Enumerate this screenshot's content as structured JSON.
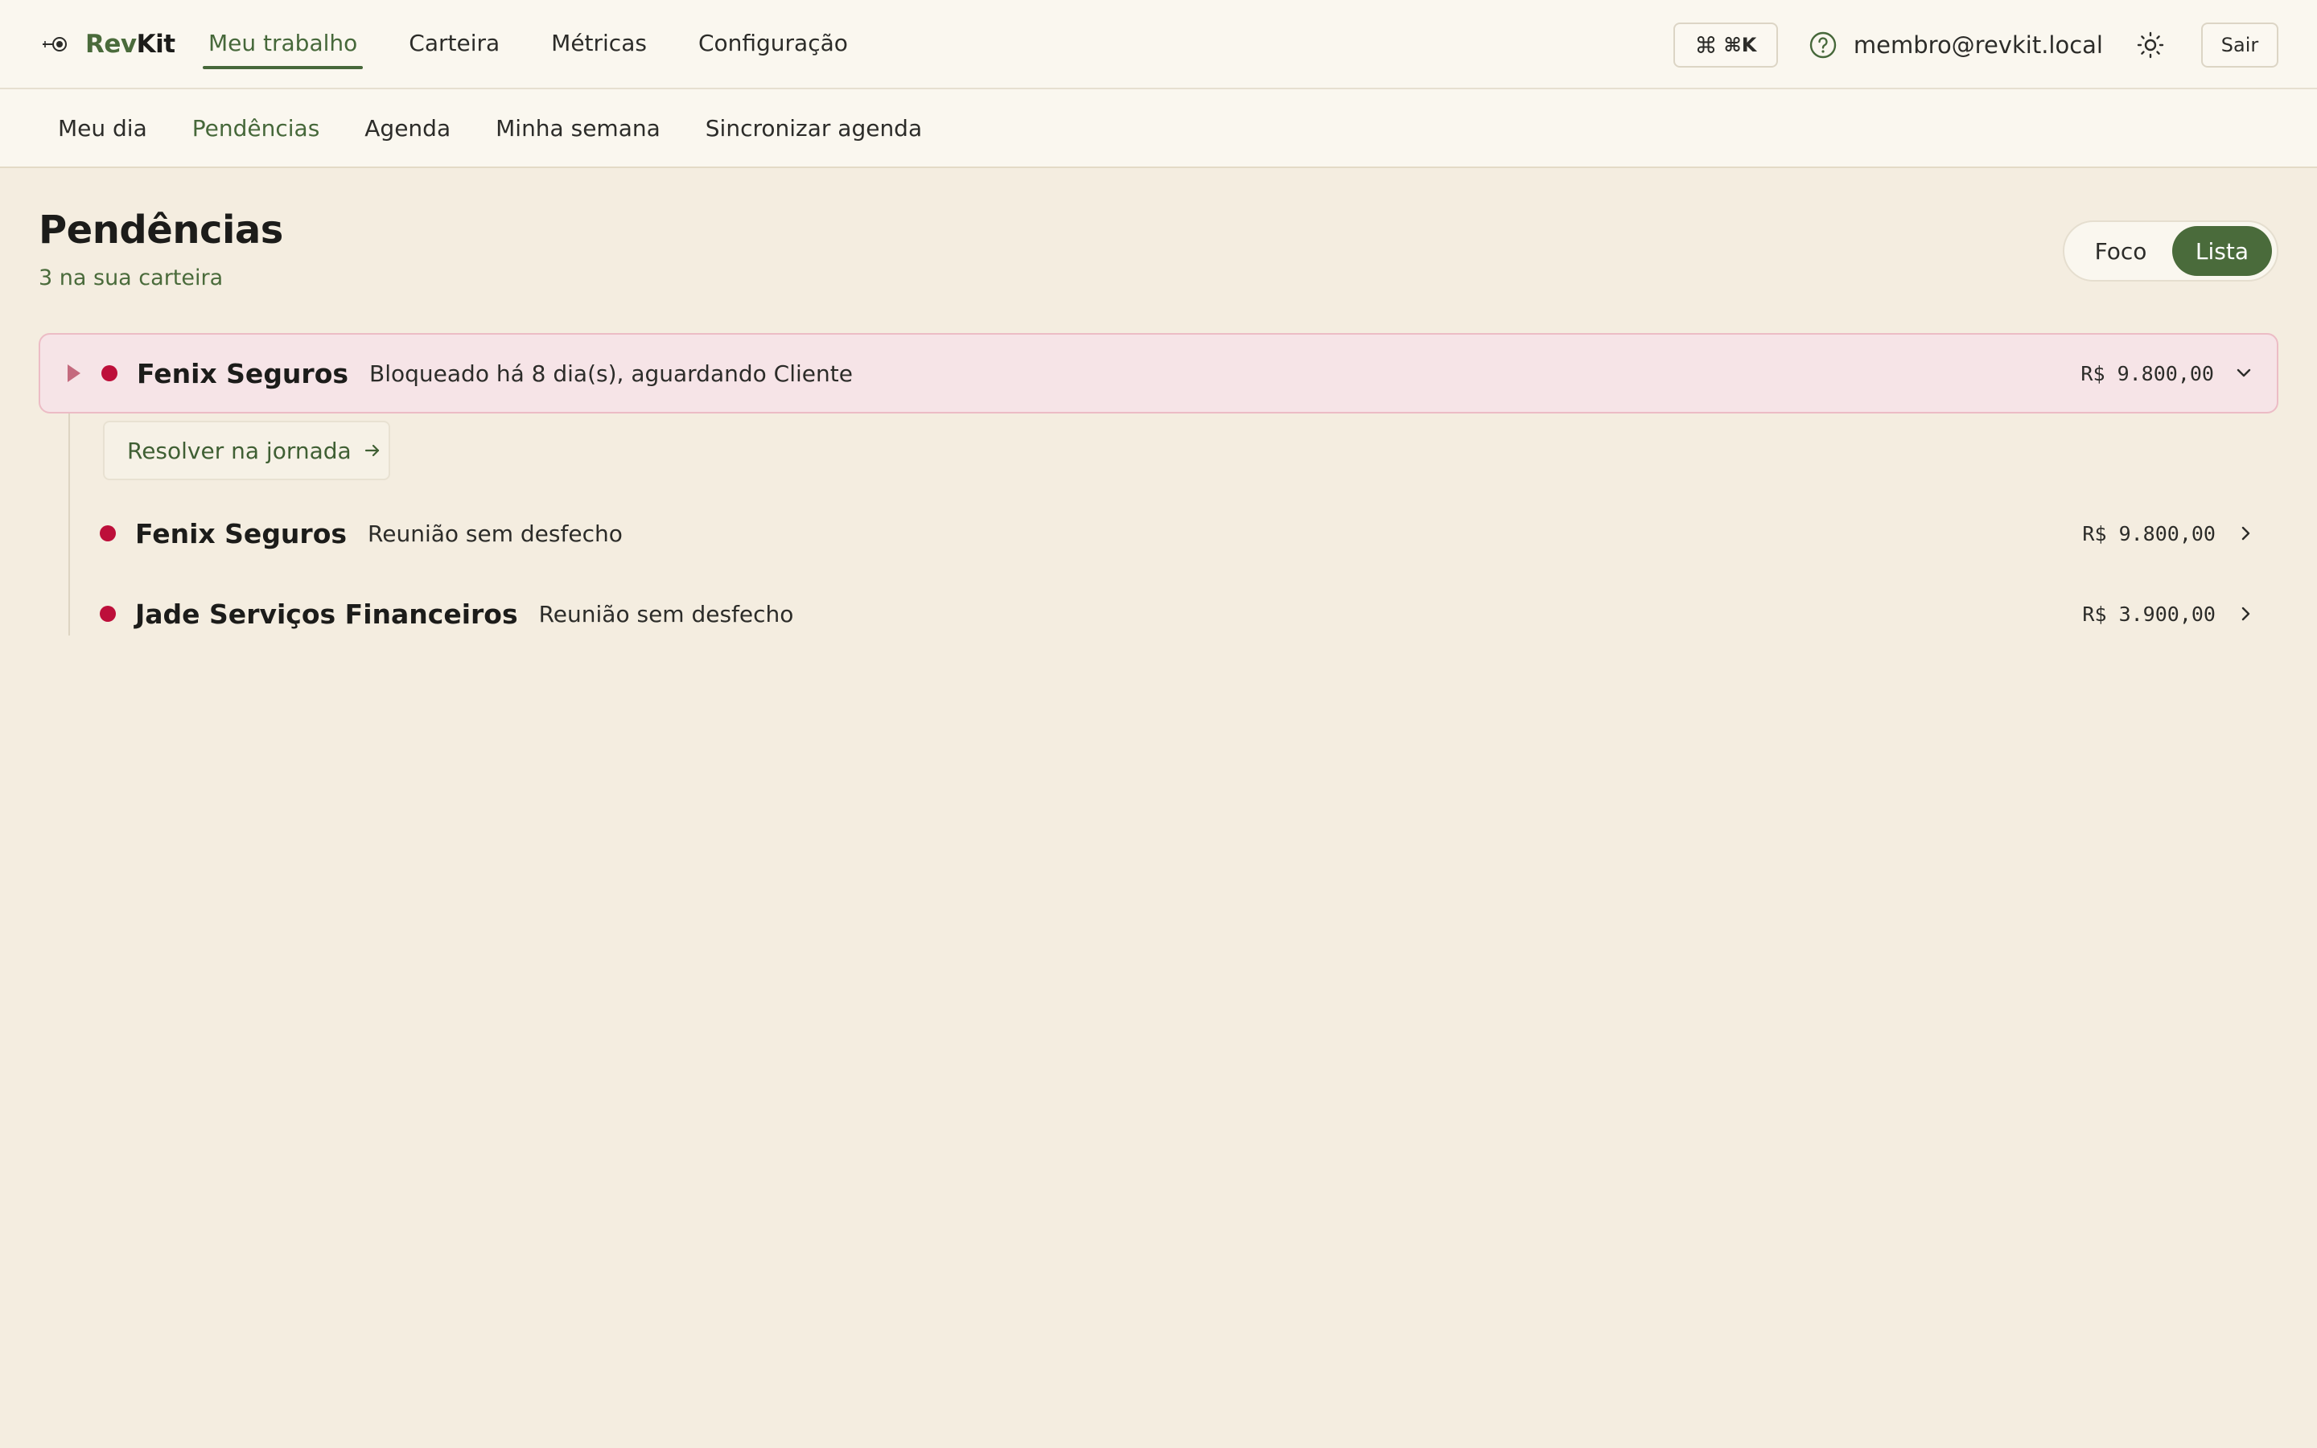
{
  "brand": {
    "prefix": "Rev",
    "suffix": "Kit"
  },
  "main_nav": [
    {
      "label": "Meu trabalho",
      "active": true
    },
    {
      "label": "Carteira",
      "active": false
    },
    {
      "label": "Métricas",
      "active": false
    },
    {
      "label": "Configuração",
      "active": false
    }
  ],
  "top_right": {
    "command_symbol": "⌘",
    "command_shortcut": "⌘K",
    "help_icon": "help-circle-icon",
    "user_email": "membro@revkit.local",
    "theme_icon": "sun-icon",
    "logout_label": "Sair"
  },
  "sub_nav": [
    {
      "label": "Meu dia",
      "active": false
    },
    {
      "label": "Pendências",
      "active": true
    },
    {
      "label": "Agenda",
      "active": false
    },
    {
      "label": "Minha semana",
      "active": false
    },
    {
      "label": "Sincronizar agenda",
      "active": false
    }
  ],
  "page": {
    "title": "Pendências",
    "subtitle": "3 na sua carteira",
    "view_toggle": {
      "options": [
        "Foco",
        "Lista"
      ],
      "selected": "Lista"
    }
  },
  "pendencias": [
    {
      "company": "Fenix Seguros",
      "status": "Bloqueado há 8 dia(s), aguardando Cliente",
      "amount": "R$ 9.800,00",
      "expanded": true,
      "action_label": "Resolver na jornada"
    },
    {
      "company": "Fenix Seguros",
      "status": "Reunião sem desfecho",
      "amount": "R$ 9.800,00",
      "expanded": false
    },
    {
      "company": "Jade Serviços Financeiros",
      "status": "Reunião sem desfecho",
      "amount": "R$ 3.900,00",
      "expanded": false
    }
  ],
  "colors": {
    "accent": "#4a6b3b",
    "background": "#f4ede0",
    "header_background": "#faf7ef",
    "status_dot": "#bd0f3a",
    "expanded_row_background": "#f6e4e7",
    "expanded_row_border": "#ecbcc5"
  }
}
